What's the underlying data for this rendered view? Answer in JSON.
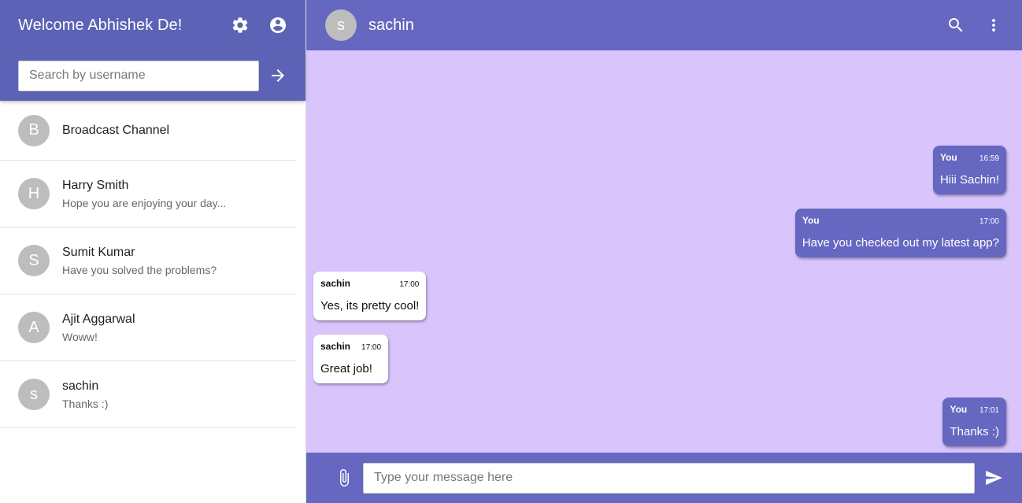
{
  "sidebar": {
    "title": "Welcome Abhishek De!",
    "settings_icon": "gear-icon",
    "account_icon": "account-circle-icon",
    "search": {
      "placeholder": "Search by username",
      "value": ""
    },
    "chats": [
      {
        "initial": "B",
        "name": "Broadcast Channel",
        "preview": ""
      },
      {
        "initial": "H",
        "name": "Harry Smith",
        "preview": "Hope you are enjoying your day..."
      },
      {
        "initial": "S",
        "name": "Sumit Kumar",
        "preview": "Have you solved the problems?"
      },
      {
        "initial": "A",
        "name": "Ajit Aggarwal",
        "preview": "Woww!"
      },
      {
        "initial": "s",
        "name": "sachin",
        "preview": "Thanks :)"
      }
    ]
  },
  "conversation": {
    "initial": "s",
    "title": "sachin",
    "messages": [
      {
        "direction": "out",
        "sender": "You",
        "time": "16:59",
        "text": "Hiii Sachin!"
      },
      {
        "direction": "out",
        "sender": "You",
        "time": "17:00",
        "text": "Have you checked out my latest app?"
      },
      {
        "direction": "in",
        "sender": "sachin",
        "time": "17:00",
        "text": "Yes, its pretty cool!"
      },
      {
        "direction": "in",
        "sender": "sachin",
        "time": "17:00",
        "text": "Great job!"
      },
      {
        "direction": "out",
        "sender": "You",
        "time": "17:01",
        "text": "Thanks :)"
      }
    ]
  },
  "composer": {
    "placeholder": "Type your message here",
    "value": ""
  },
  "colors": {
    "sidebar_header": "#5c62b5",
    "chat_header": "#6567c1",
    "chat_background": "#d9c5fc",
    "outgoing_bubble": "#6567c1",
    "incoming_bubble": "#ffffff"
  }
}
